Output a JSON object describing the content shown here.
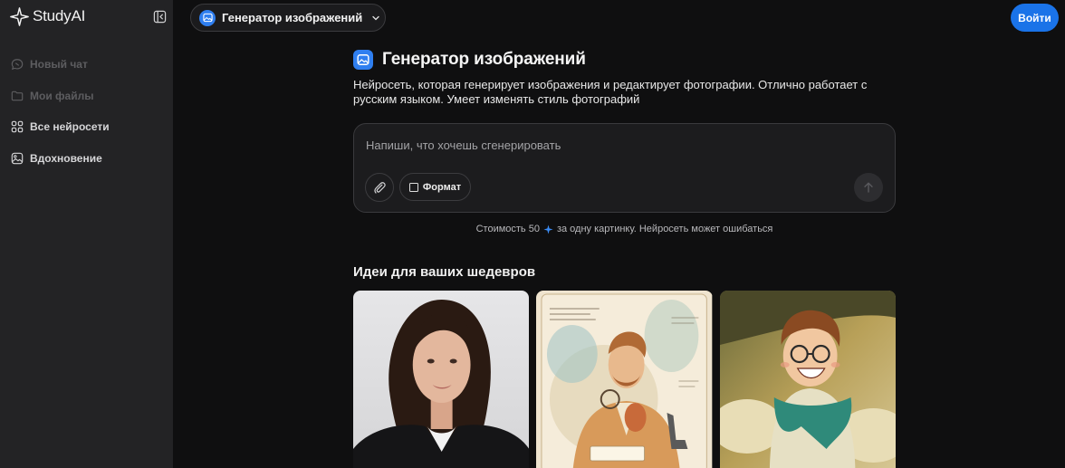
{
  "app": {
    "name": "StudyAI"
  },
  "sidebar": {
    "items": [
      {
        "label": "Новый чат",
        "icon": "chat-bubble-icon",
        "enabled": false
      },
      {
        "label": "Мои файлы",
        "icon": "folder-icon",
        "enabled": false
      },
      {
        "label": "Все нейросети",
        "icon": "grid-icon",
        "enabled": true
      },
      {
        "label": "Вдохновение",
        "icon": "image-icon",
        "enabled": true
      }
    ]
  },
  "header": {
    "model_selector_label": "Генератор изображений",
    "login_label": "Войти"
  },
  "main": {
    "title": "Генератор изображений",
    "description": "Нейросеть, которая генерирует изображения и редактирует фотографии. Отлично работает с русским языком. Умеет изменять стиль фотографий",
    "prompt": {
      "placeholder": "Напиши, что хочешь сгенерировать",
      "value": "",
      "format_label": "Формат"
    },
    "cost": {
      "prefix": "Стоимость 50",
      "suffix": "за одну картинку. Нейросеть может ошибаться"
    },
    "ideas_title": "Идеи для ваших шедевров",
    "ideas": [
      {
        "subject": "portrait-photo"
      },
      {
        "subject": "watercolor-scientist-illustration"
      },
      {
        "subject": "anime-laughing-boy"
      }
    ]
  },
  "colors": {
    "accent": "#1a73e8",
    "sidebar_bg": "#232325",
    "page_bg": "#0f0f10"
  }
}
